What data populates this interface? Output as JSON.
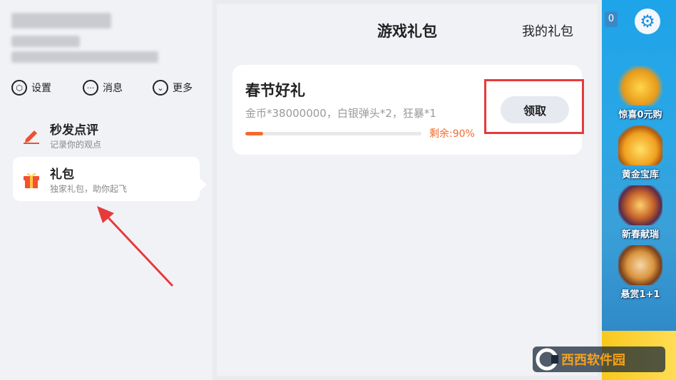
{
  "sidebar": {
    "actions": [
      {
        "label": "设置",
        "icon": "settings-icon"
      },
      {
        "label": "消息",
        "icon": "message-icon"
      },
      {
        "label": "更多",
        "icon": "more-icon"
      }
    ],
    "menu": [
      {
        "title": "秒发点评",
        "subtitle": "记录你的观点",
        "icon": "pencil-icon"
      },
      {
        "title": "礼包",
        "subtitle": "独家礼包，助你起飞",
        "icon": "gift-icon"
      }
    ]
  },
  "main": {
    "title": "游戏礼包",
    "my_gifts": "我的礼包",
    "gift": {
      "name": "春节好礼",
      "desc": "金币*38000000，白银弹头*2，狂暴*1",
      "remaining_label": "剩余:90%",
      "progress_used": 0.1,
      "claim_label": "领取"
    }
  },
  "game_panel": {
    "badge": "0",
    "items": [
      {
        "label": "惊喜0元购"
      },
      {
        "label": "黄金宝库"
      },
      {
        "label": "新春献瑞"
      },
      {
        "label": "悬赏1+1"
      }
    ]
  },
  "watermark": "西西软件园",
  "colors": {
    "accent": "#f26a2f",
    "highlight": "#e53b3b"
  }
}
